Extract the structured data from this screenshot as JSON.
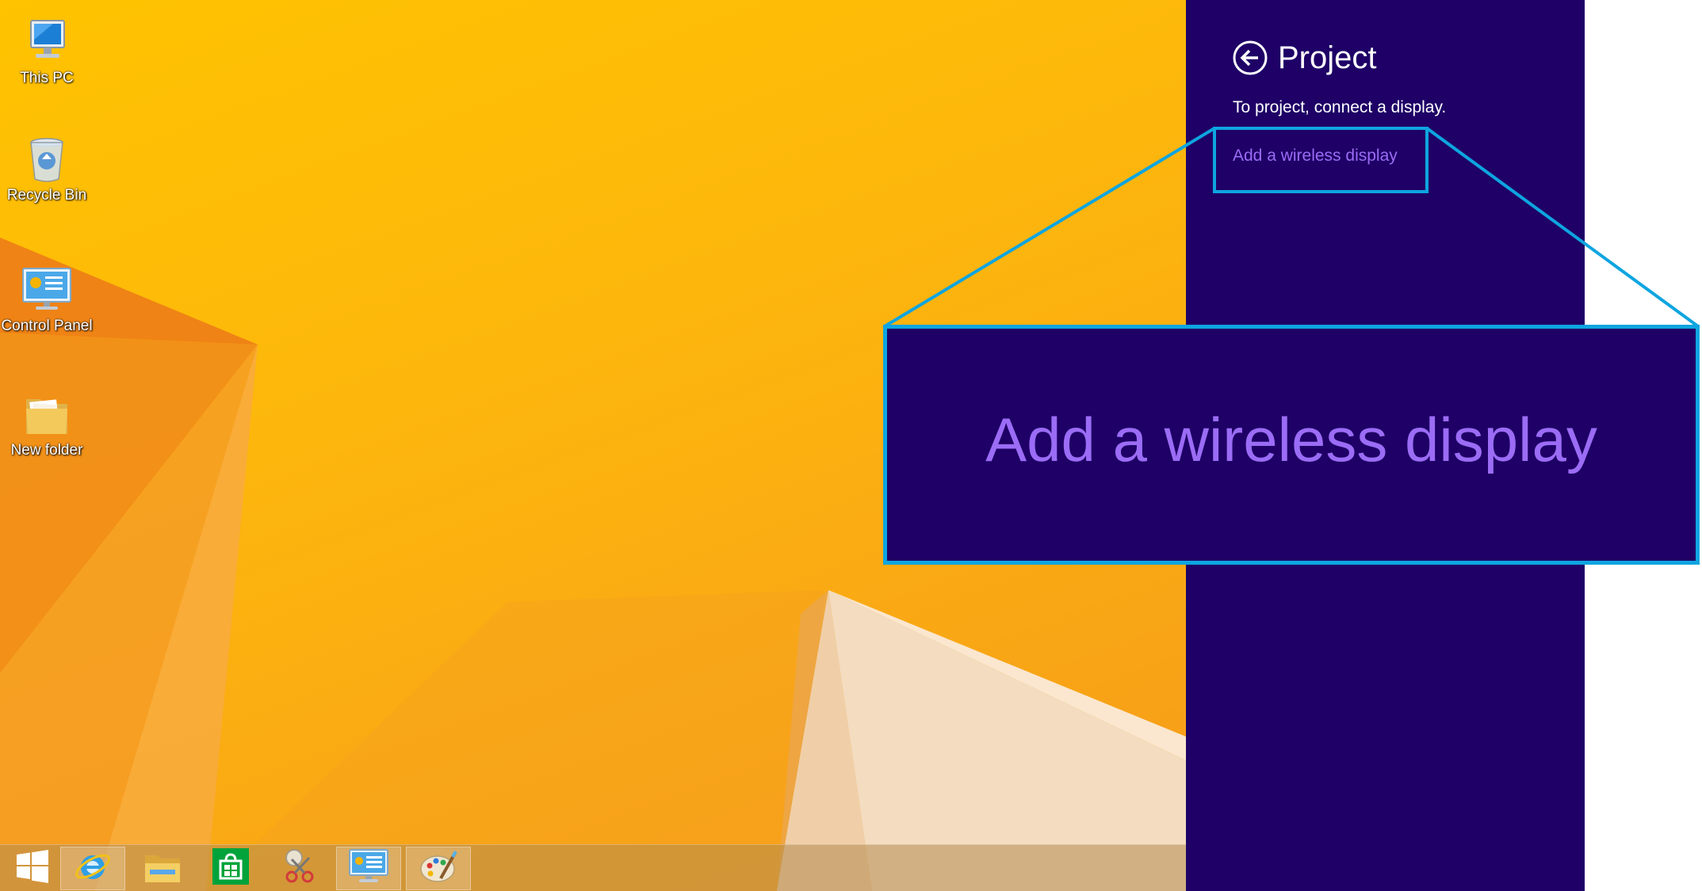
{
  "desktop": {
    "icons": [
      {
        "label": "This PC",
        "icon": "computer-icon"
      },
      {
        "label": "Recycle Bin",
        "icon": "recycle-bin-icon"
      },
      {
        "label": "Control Panel",
        "icon": "control-panel-icon"
      },
      {
        "label": "New folder",
        "icon": "folder-icon"
      }
    ]
  },
  "taskbar": {
    "items": [
      {
        "icon": "windows-start-icon"
      },
      {
        "icon": "internet-explorer-icon"
      },
      {
        "icon": "file-explorer-icon"
      },
      {
        "icon": "store-icon"
      },
      {
        "icon": "snipping-tool-icon"
      },
      {
        "icon": "control-panel-icon"
      },
      {
        "icon": "paint-icon"
      }
    ]
  },
  "charm": {
    "title": "Project",
    "subtitle": "To project, connect a display.",
    "link": "Add a wireless display"
  },
  "callout": {
    "zoom_text": "Add a wireless display"
  },
  "colors": {
    "charm_background": "#1e0066",
    "link": "#9b6cf5",
    "highlight": "#0ea5e0",
    "wallpaper": "#fdb70c"
  }
}
